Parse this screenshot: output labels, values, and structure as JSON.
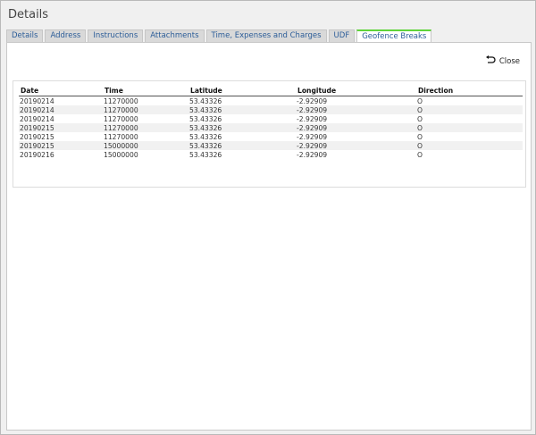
{
  "window": {
    "title": "Details"
  },
  "tabs": [
    {
      "label": "Details"
    },
    {
      "label": "Address"
    },
    {
      "label": "Instructions"
    },
    {
      "label": "Attachments"
    },
    {
      "label": "Time, Expenses and Charges"
    },
    {
      "label": "UDF"
    },
    {
      "label": "Geofence Breaks"
    }
  ],
  "active_tab": "Geofence Breaks",
  "toolbar": {
    "close_label": "Close"
  },
  "table": {
    "headers": [
      "Date",
      "Time",
      "Latitude",
      "Longitude",
      "Direction"
    ],
    "rows": [
      [
        "20190214",
        "11270000",
        "53.43326",
        "-2.92909",
        "O"
      ],
      [
        "20190214",
        "11270000",
        "53.43326",
        "-2.92909",
        "O"
      ],
      [
        "20190214",
        "11270000",
        "53.43326",
        "-2.92909",
        "O"
      ],
      [
        "20190215",
        "11270000",
        "53.43326",
        "-2.92909",
        "O"
      ],
      [
        "20190215",
        "11270000",
        "53.43326",
        "-2.92909",
        "O"
      ],
      [
        "20190215",
        "15000000",
        "53.43326",
        "-2.92909",
        "O"
      ],
      [
        "20190216",
        "15000000",
        "53.43326",
        "-2.92909",
        "O"
      ]
    ]
  },
  "colors": {
    "active_tab_accent": "#5fd33a",
    "tab_text": "#2c5d98"
  }
}
